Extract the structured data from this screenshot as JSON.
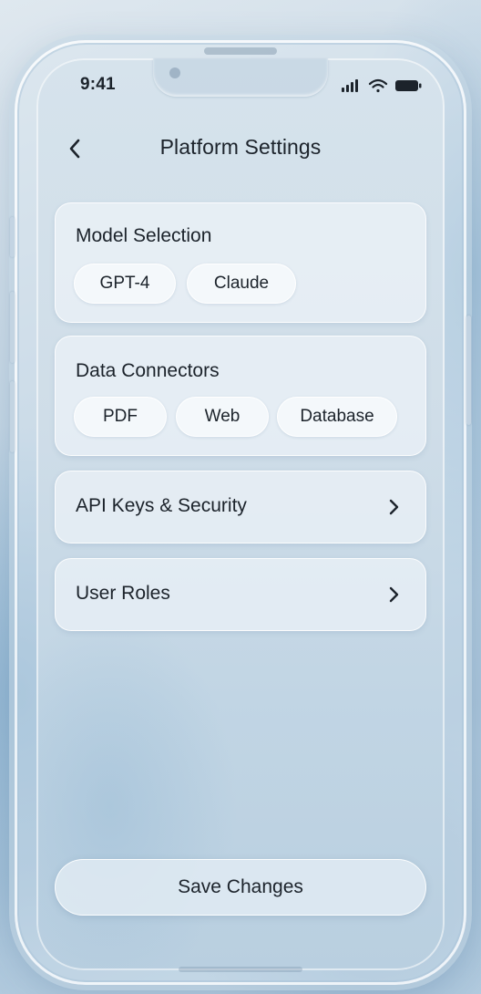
{
  "status_bar": {
    "time": "9:41",
    "icons": [
      "signal-icon",
      "wifi-icon",
      "battery-icon"
    ]
  },
  "header": {
    "back_icon": "chevron-left-icon",
    "title": "Platform Settings"
  },
  "sections": {
    "model_selection": {
      "title": "Model Selection",
      "options": [
        "GPT-4",
        "Claude"
      ]
    },
    "data_connectors": {
      "title": "Data Connectors",
      "options": [
        "PDF",
        "Web",
        "Database"
      ]
    },
    "api_keys": {
      "label": "API Keys & Security",
      "icon": "chevron-right-icon"
    },
    "user_roles": {
      "label": "User Roles",
      "icon": "chevron-right-icon"
    }
  },
  "footer": {
    "save_label": "Save Changes"
  },
  "colors": {
    "text": "#1c232b",
    "background": "#b5cde0",
    "card": "#edf3f8"
  }
}
